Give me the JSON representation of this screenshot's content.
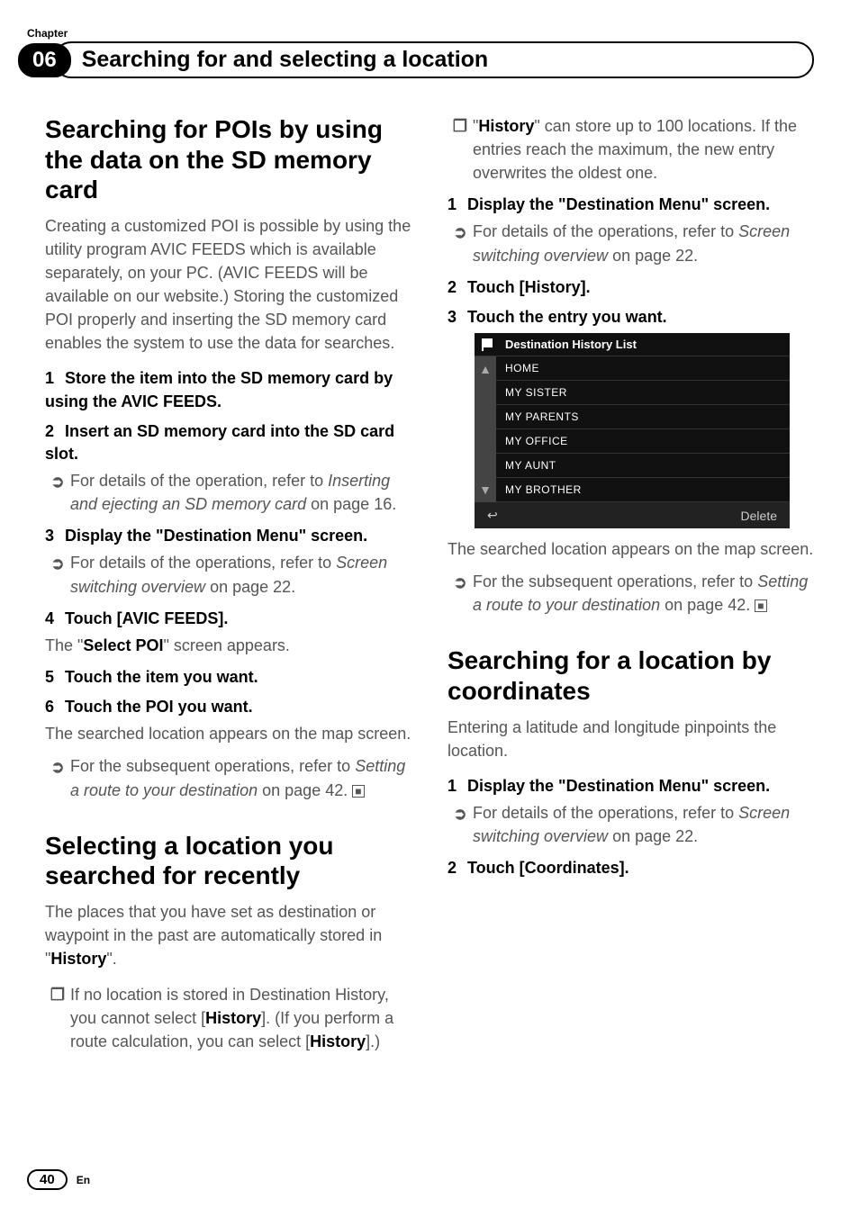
{
  "header": {
    "chapter_label": "Chapter",
    "chapter_num": "06",
    "title": "Searching for and selecting a location"
  },
  "left": {
    "s1": {
      "heading": "Searching for POIs by using the data on the SD memory card",
      "intro": "Creating a customized POI is possible by using the utility program AVIC FEEDS which is available separately, on your PC. (AVIC FEEDS will be available on our website.) Storing the customized POI properly and inserting the SD memory card enables the system to use the data for searches.",
      "step1": "Store the item into the SD memory card by using the AVIC FEEDS.",
      "step2": "Insert an SD memory card into the SD card slot.",
      "ref2a": "For details of the operation, refer to ",
      "ref2b": "Inserting and ejecting an SD memory card",
      "ref2c": " on page 16.",
      "step3": "Display the \"Destination Menu\" screen.",
      "ref3a": "For details of the operations, refer to ",
      "ref3b": "Screen switching overview",
      "ref3c": " on page 22.",
      "step4": "Touch [AVIC FEEDS].",
      "after4a": "The \"",
      "after4b": "Select POI",
      "after4c": "\" screen appears.",
      "step5": "Touch the item you want.",
      "step6": "Touch the POI you want.",
      "after6": "The searched location appears on the map screen.",
      "ref6a": "For the subsequent operations, refer to ",
      "ref6b": "Setting a route to your destination",
      "ref6c": " on page 42."
    },
    "s2": {
      "heading": "Selecting a location you searched for recently",
      "intro_a": "The places that you have set as destination or waypoint in the past are automatically stored in \"",
      "intro_b": "History",
      "intro_c": "\".",
      "note1a": "If no location is stored in Destination History, you cannot select [",
      "note1b": "History",
      "note1c": "]. (If you perform a route calculation, you can select [",
      "note1d": "History",
      "note1e": "].)"
    }
  },
  "right": {
    "note2a": "\"",
    "note2b": "History",
    "note2c": "\" can store up to 100 locations. If the entries reach the maximum, the new entry overwrites the oldest one.",
    "step1": "Display the \"Destination Menu\" screen.",
    "ref1a": "For details of the operations, refer to ",
    "ref1b": "Screen switching overview",
    "ref1c": " on page 22.",
    "step2": "Touch [History].",
    "step3": "Touch the entry you want.",
    "screenshot": {
      "title": "Destination History List",
      "items": [
        "HOME",
        "MY SISTER",
        "MY PARENTS",
        "MY OFFICE",
        "MY AUNT",
        "MY BROTHER"
      ],
      "delete": "Delete"
    },
    "afterSS": "The searched location appears on the map screen.",
    "refSSa": "For the subsequent operations, refer to ",
    "refSSb": "Setting a route to your destination",
    "refSSc": " on page 42.",
    "s3": {
      "heading": "Searching for a location by coordinates",
      "intro": "Entering a latitude and longitude pinpoints the location.",
      "step1": "Display the \"Destination Menu\" screen.",
      "ref1a": "For details of the operations, refer to ",
      "ref1b": "Screen switching overview",
      "ref1c": " on page 22.",
      "step2": "Touch [Coordinates]."
    }
  },
  "footer": {
    "page": "40",
    "lang": "En"
  }
}
